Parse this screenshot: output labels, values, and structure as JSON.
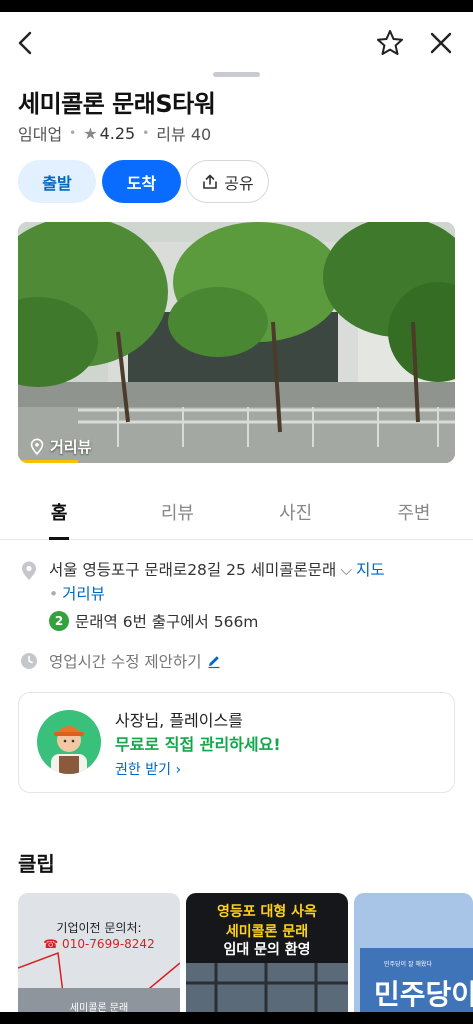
{
  "place": {
    "name": "세미콜론 문래S타워",
    "category": "임대업",
    "rating": "4.25",
    "review_label": "리뷰 40"
  },
  "actions": {
    "depart": "출발",
    "arrive": "도착",
    "share": "공유"
  },
  "photo": {
    "street_view_label": "거리뷰"
  },
  "tabs": [
    "홈",
    "리뷰",
    "사진",
    "주변"
  ],
  "info": {
    "address": "서울 영등포구 문래로28길 25 세미콜론문래",
    "map_link": "지도",
    "street_view_link": "거리뷰",
    "subway_line": "2",
    "subway_text": "문래역 6번 출구에서 566m",
    "hours_suggest": "영업시간 수정 제안하기"
  },
  "owner_card": {
    "line1": "사장님, 플레이스를",
    "line2": "무료로 직접 관리하세요!",
    "link": "권한 받기"
  },
  "clips": {
    "title": "클립",
    "items": [
      {
        "line1": "기업이전 문의처:",
        "line2": "☎ 010-7699-8242",
        "line3": "세미콜론 문래"
      },
      {
        "line1": "영등포 대형 사옥",
        "line2": "세미콜론 문래",
        "line3": "임대 문의 환영"
      },
      {
        "line1": "민주당이",
        "small": "민주당이 잘 해왔다"
      }
    ]
  },
  "colors": {
    "accent": "#0a6cff",
    "link": "#0068c3",
    "subway_line2": "#33a23d",
    "promo_green": "#12a84a"
  }
}
